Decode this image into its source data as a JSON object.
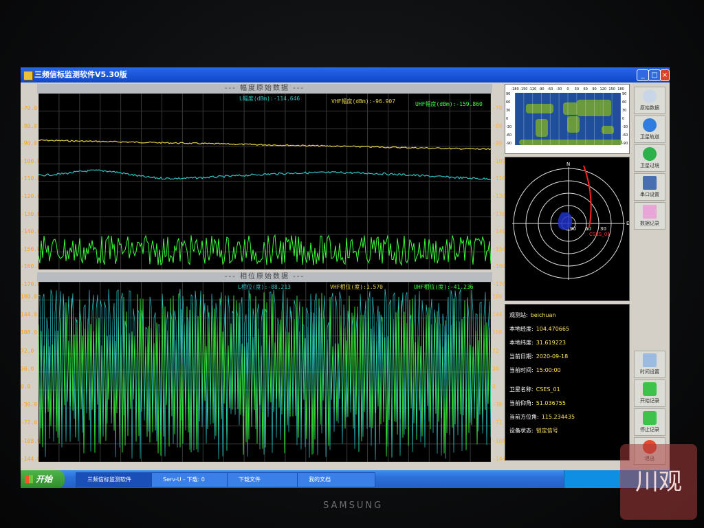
{
  "window": {
    "title": "三频信标监测软件V5.30版"
  },
  "amplitude_panel": {
    "title": "--- 幅度原始数据 ---",
    "readouts": {
      "l_band": "L幅度(dBm):-114.646",
      "vhf": "VHF幅度(dBm):-96.907",
      "uhf": "UHF幅度(dBm):-159.860"
    },
    "y_ticks": [
      "-70.0",
      "-80.0",
      "-90.0",
      "-100.0",
      "-110.0",
      "-120.0",
      "-130.0",
      "-140.0",
      "-150.0",
      "-160.0",
      "-170.0"
    ],
    "y_ticks_right": [
      "-70",
      "-80",
      "-90",
      "-100",
      "-110",
      "-120",
      "-130",
      "-140",
      "-150",
      "-160",
      "-170"
    ]
  },
  "phase_panel": {
    "title": "--- 相位原始数据 ---",
    "readouts": {
      "l_band": "L相位(度):-88.213",
      "vhf": "VHF相位(度):1.570",
      "uhf": "UHF相位(度):-41.236"
    },
    "y_ticks": [
      "180.0",
      "144.0",
      "108.0",
      "72.0",
      "36.0",
      "0.0",
      "-36.0",
      "-72.0",
      "-108.0",
      "-144.0",
      "-180.0"
    ],
    "y_ticks_right": [
      "180",
      "144",
      "108",
      "72",
      "36",
      "0",
      "-36",
      "-72",
      "-108",
      "-144",
      "-180"
    ]
  },
  "world_map": {
    "top_scale": [
      "-180",
      "-150",
      "-120",
      "-90",
      "-60",
      "-30",
      "0",
      "30",
      "60",
      "90",
      "120",
      "150",
      "180"
    ],
    "left_scale": [
      "90",
      "60",
      "30",
      "0",
      "-30",
      "-60",
      "-90"
    ],
    "right_scale": [
      "90",
      "60",
      "30",
      "0",
      "-30",
      "-60",
      "-90"
    ]
  },
  "polar_plot": {
    "north": "N",
    "east": "E",
    "rings": [
      "90",
      "60",
      "30"
    ],
    "satellite_label": "CSES_01"
  },
  "station_info": {
    "station_label": "观测站:",
    "station_value": "beichuan",
    "lon_label": "本地经度:",
    "lon_value": "104.470665",
    "lat_label": "本地纬度:",
    "lat_value": "31.619223",
    "date_label": "当前日期:",
    "date_value": "2020-09-18",
    "time_label": "当前时间:",
    "time_value": "15:00:00",
    "sat_label": "卫星名称:",
    "sat_value": "CSES_01",
    "elev_label": "当前仰角:",
    "elev_value": "51.036755",
    "azim_label": "当前方位角:",
    "azim_value": "115.234435",
    "status_label": "设备状态:",
    "status_value": "锁定信号"
  },
  "sidebar": {
    "raw_data": "原始数据",
    "sat_orbit": "卫星轨道",
    "sat_pass": "卫星过境",
    "port_settings": "串口设置",
    "record": "数据记录",
    "timer_settings": "时间设置",
    "start_record": "开始记录",
    "stop_record": "停止记录",
    "exit": "退出"
  },
  "taskbar": {
    "start": "开始",
    "task1": "三频信标监测软件",
    "task2": "Serv-U - 下载: 0",
    "task3": "下载文件",
    "task4": "我的文档"
  },
  "brand": "SAMSUNG",
  "watermark": "川观",
  "colors": {
    "l_band": "#e8d24a",
    "vhf": "#2ec5c9",
    "uhf": "#3dff3d",
    "accent": "#ff9e1a"
  }
}
